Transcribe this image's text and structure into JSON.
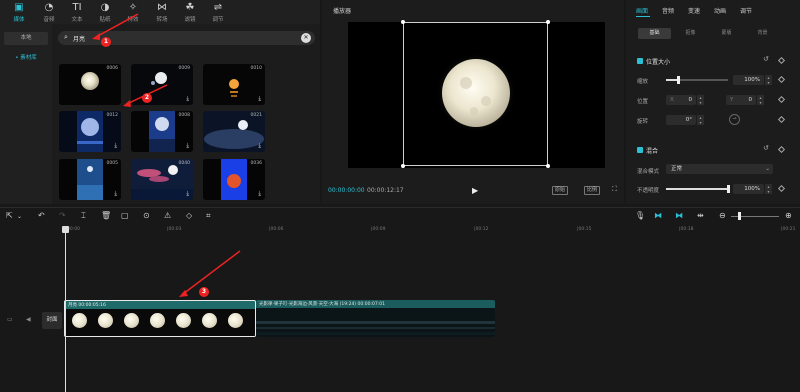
{
  "toolbar": {
    "items": [
      {
        "label": "媒体",
        "icon": "media-icon"
      },
      {
        "label": "音频",
        "icon": "audio-icon"
      },
      {
        "label": "文本",
        "icon": "text-icon"
      },
      {
        "label": "贴纸",
        "icon": "sticker-icon"
      },
      {
        "label": "特效",
        "icon": "effects-icon"
      },
      {
        "label": "转场",
        "icon": "transition-icon"
      },
      {
        "label": "滤镜",
        "icon": "filter-icon"
      },
      {
        "label": "调节",
        "icon": "adjust-icon"
      }
    ]
  },
  "leftnav": {
    "local": "本地",
    "library": "• 素材库"
  },
  "search": {
    "value": "月亮"
  },
  "media": {
    "items": [
      {
        "num": "0006"
      },
      {
        "num": "0009"
      },
      {
        "num": "0010"
      },
      {
        "num": "0012"
      },
      {
        "num": "0008"
      },
      {
        "num": "0021"
      },
      {
        "num": "0005"
      },
      {
        "num": "0040"
      },
      {
        "num": "0036"
      }
    ]
  },
  "player": {
    "title": "播放器",
    "time_current": "00:00:00:00",
    "time_total": "00:00:12:17",
    "btn_original": "原始",
    "btn_ratio": "比例"
  },
  "props": {
    "tabs": [
      "画面",
      "音频",
      "变速",
      "动画",
      "调节"
    ],
    "subtabs": [
      "基础",
      "抠像",
      "蒙版",
      "背景"
    ],
    "section_position": "位置大小",
    "scale_label": "缩放",
    "scale_value": "100%",
    "scale_pct": 0.2,
    "position_label": "位置",
    "pos_x_prefix": "X",
    "pos_x": "0",
    "pos_y_prefix": "Y",
    "pos_y": "0",
    "rotation_label": "旋转",
    "rotation_value": "0°",
    "section_blend": "混合",
    "blend_mode_label": "混合模式",
    "blend_mode_value": "正常",
    "opacity_label": "不透明度",
    "opacity_value": "100%",
    "opacity_pct": 1.0
  },
  "timeline": {
    "ticks": [
      "00:00",
      "|00:03",
      "|00:06",
      "|00:09",
      "|00:12",
      "|00:15",
      "|00:18",
      "|00:21"
    ],
    "cover": "封面",
    "clip1_label": "月亮  00:00:05:16",
    "clip2_label": "光影律·果子叮·光影海边·风景·天空·大海  (19:24)  00:00:07:01"
  },
  "annotations": [
    "1",
    "2",
    "3"
  ],
  "colors": {
    "accent": "#2cc0d4",
    "annotation": "#e22222"
  }
}
